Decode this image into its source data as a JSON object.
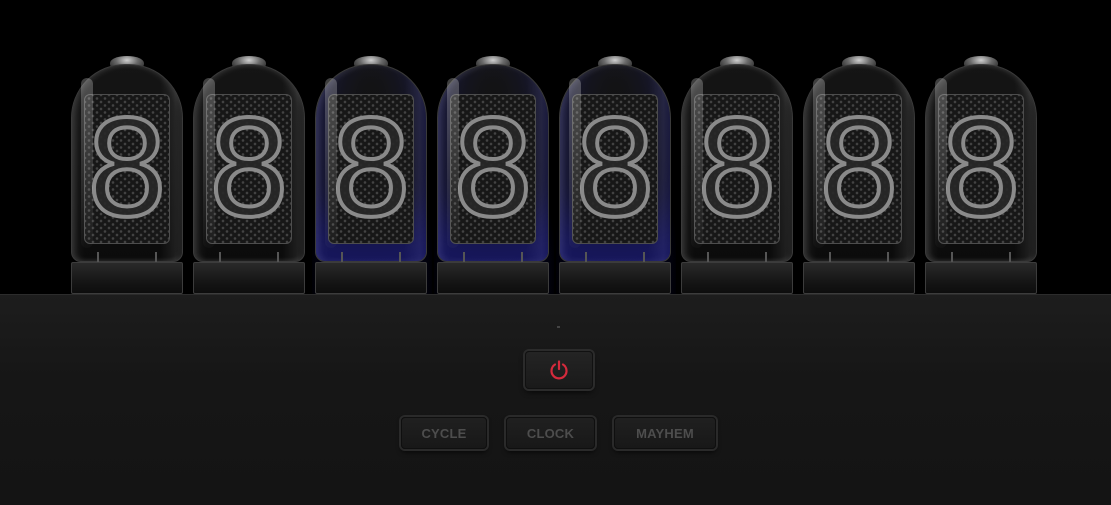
{
  "tubes": [
    {
      "digit": "8",
      "glow": false
    },
    {
      "digit": "8",
      "glow": false
    },
    {
      "digit": "8",
      "glow": true
    },
    {
      "digit": "8",
      "glow": true
    },
    {
      "digit": "8",
      "glow": true
    },
    {
      "digit": "8",
      "glow": false
    },
    {
      "digit": "8",
      "glow": false
    },
    {
      "digit": "8",
      "glow": false
    }
  ],
  "controls": {
    "power_icon": "power-icon",
    "power_color": "#d42a3c",
    "cycle_label": "CYCLE",
    "clock_label": "CLOCK",
    "mayhem_label": "MAYHEM"
  },
  "colors": {
    "glow": "#1e1ebe",
    "digit_outline": "#8a8a8a",
    "button_text": "#4d4d4d"
  }
}
